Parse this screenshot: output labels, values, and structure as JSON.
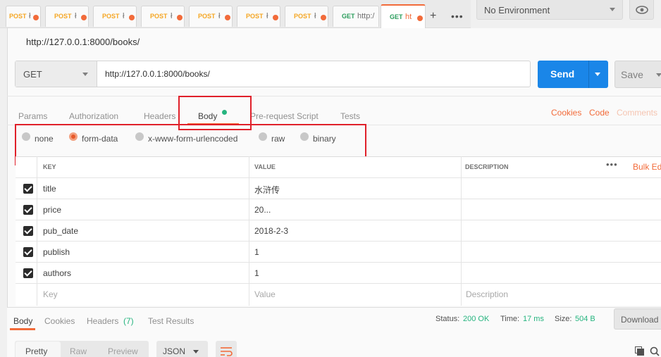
{
  "request_tabs": [
    {
      "method": "POST",
      "url": "",
      "active": false
    },
    {
      "method": "POST",
      "url": "",
      "active": false
    },
    {
      "method": "POST",
      "url": "",
      "active": false
    },
    {
      "method": "POST",
      "url": "",
      "active": false
    },
    {
      "method": "POST",
      "url": "",
      "active": false
    },
    {
      "method": "POST",
      "url": "",
      "active": false
    },
    {
      "method": "POST",
      "url": "",
      "active": false
    },
    {
      "method": "GET",
      "url": "http:/",
      "active": false
    },
    {
      "method": "GET",
      "url": "ht",
      "active": true
    }
  ],
  "tabbar": {
    "new_tab_icon": "+",
    "more_icon": "•••"
  },
  "environment": {
    "selected": "No Environment"
  },
  "request": {
    "name": "http://127.0.0.1:8000/books/",
    "method": "GET",
    "url": "http://127.0.0.1:8000/books/",
    "send_label": "Send",
    "save_label": "Save"
  },
  "subtabs": {
    "items": [
      "Params",
      "Authorization",
      "Headers",
      "Body",
      "Pre-request Script",
      "Tests"
    ],
    "active": "Body",
    "right_links": [
      "Cookies",
      "Code",
      "Comments"
    ]
  },
  "body_modes": {
    "options": [
      "none",
      "form-data",
      "x-www-form-urlencoded",
      "raw",
      "binary"
    ],
    "selected": "form-data"
  },
  "table": {
    "headers": {
      "key": "KEY",
      "value": "VALUE",
      "description": "DESCRIPTION",
      "bulk_edit": "Bulk Ed"
    },
    "rows": [
      {
        "checked": true,
        "key": "title",
        "value": "水浒传"
      },
      {
        "checked": true,
        "key": "price",
        "value": "20..."
      },
      {
        "checked": true,
        "key": "pub_date",
        "value": "2018-2-3"
      },
      {
        "checked": true,
        "key": "publish",
        "value": "1"
      },
      {
        "checked": true,
        "key": "authors",
        "value": "1"
      }
    ],
    "placeholders": {
      "key": "Key",
      "value": "Value",
      "description": "Description"
    }
  },
  "response": {
    "tabs": [
      "Body",
      "Cookies",
      "Headers",
      "Test Results"
    ],
    "headers_count": "(7)",
    "active": "Body",
    "status_label": "Status:",
    "status": "200 OK",
    "time_label": "Time:",
    "time": "17 ms",
    "size_label": "Size:",
    "size": "504 B",
    "download_label": "Download",
    "formats": [
      "Pretty",
      "Raw",
      "Preview"
    ],
    "format_active": "Pretty",
    "language": "JSON"
  },
  "colors": {
    "accent": "#f26b3a",
    "send_blue": "#1a86e8",
    "status_green": "#26b47f",
    "highlight_red": "#e0202a"
  }
}
